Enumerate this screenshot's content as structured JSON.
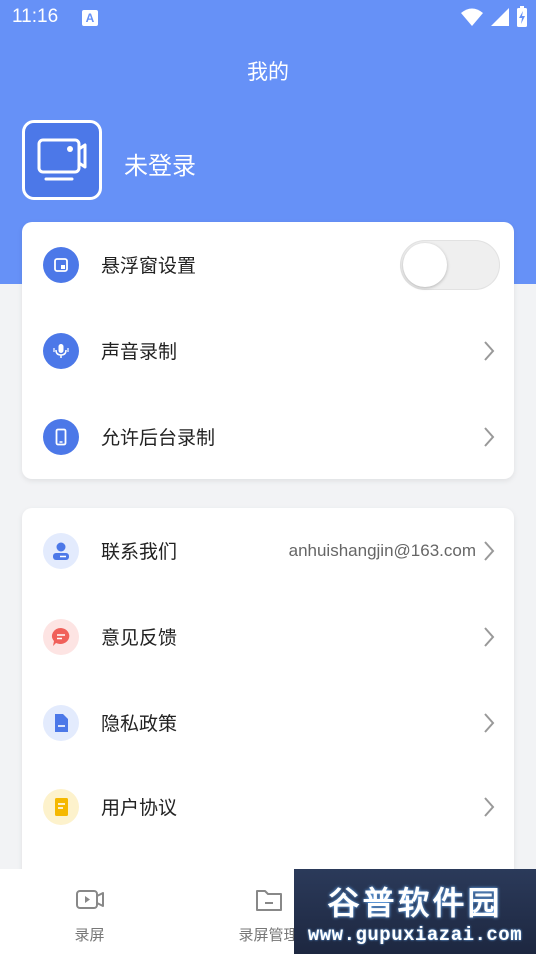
{
  "status_bar": {
    "time": "11:16",
    "notification": "A"
  },
  "header": {
    "title": "我的"
  },
  "user": {
    "name": "未登录"
  },
  "settings_card": {
    "items": [
      {
        "label": "悬浮窗设置",
        "toggle_on": false
      },
      {
        "label": "声音录制"
      },
      {
        "label": "允许后台录制"
      }
    ]
  },
  "info_card": {
    "items": [
      {
        "label": "联系我们",
        "value": "anhuishangjin@163.com"
      },
      {
        "label": "意见反馈"
      },
      {
        "label": "隐私政策"
      },
      {
        "label": "用户协议"
      }
    ]
  },
  "tabbar": {
    "tabs": [
      {
        "label": "录屏"
      },
      {
        "label": "录屏管理"
      }
    ]
  },
  "watermark": {
    "text": "谷普软件园",
    "url": "www.gupuxiazai.com"
  },
  "colors": {
    "primary": "#6691f7",
    "icon_blue": "#4c78e8",
    "feedback_red": "#f0605a",
    "agreement_yellow": "#f5b800"
  }
}
